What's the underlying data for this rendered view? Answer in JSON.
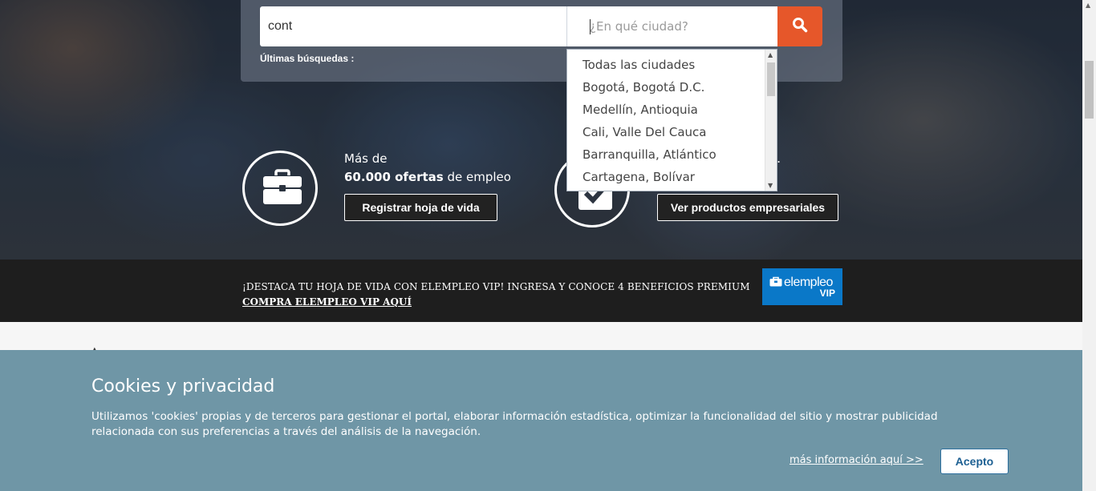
{
  "search": {
    "keyword_value": "cont",
    "city_placeholder": "¿En qué ciudad?",
    "recent_label": "Últimas búsquedas :"
  },
  "city_dropdown": {
    "options": [
      "Todas las ciudades",
      "Bogotá, Bogotá D.C.",
      "Medellín, Antioquia",
      "Cali, Valle Del Cauca",
      "Barranquilla, Atlántico",
      "Cartagena, Bolívar"
    ]
  },
  "features": {
    "offers_prefix": "Más de",
    "offers_count": "60.000 ofertas",
    "offers_suffix": " de empleo",
    "register_button": "Registrar hoja de vida",
    "products_button": "Ver productos empresariales",
    "trailing_mark": "."
  },
  "vip_banner": {
    "headline": "¡DESTACA TU HOJA DE VIDA CON ELEMPLEO VIP! INGRESA Y CONOCE 4 BENEFICIOS PREMIUM",
    "link": "COMPRA ELEMPLEO VIP AQUÍ",
    "logo_brand": "elempleo",
    "logo_vip": "VIP"
  },
  "cookies": {
    "title": "Cookies y privacidad",
    "text": "Utilizamos 'cookies' propias y de terceros para gestionar el portal, elaborar información estadística, optimizar la funcionalidad del sitio y mostrar publicidad relacionada con sus preferencias a través del análisis de la navegación.",
    "more_link": "más información aquí >>",
    "accept_button": "Acepto"
  },
  "colors": {
    "search_button": "#e6572a",
    "cookie_background": "#6f96a6",
    "vip_logo": "#0a78c8",
    "vip_banner": "#1e1e1e"
  }
}
